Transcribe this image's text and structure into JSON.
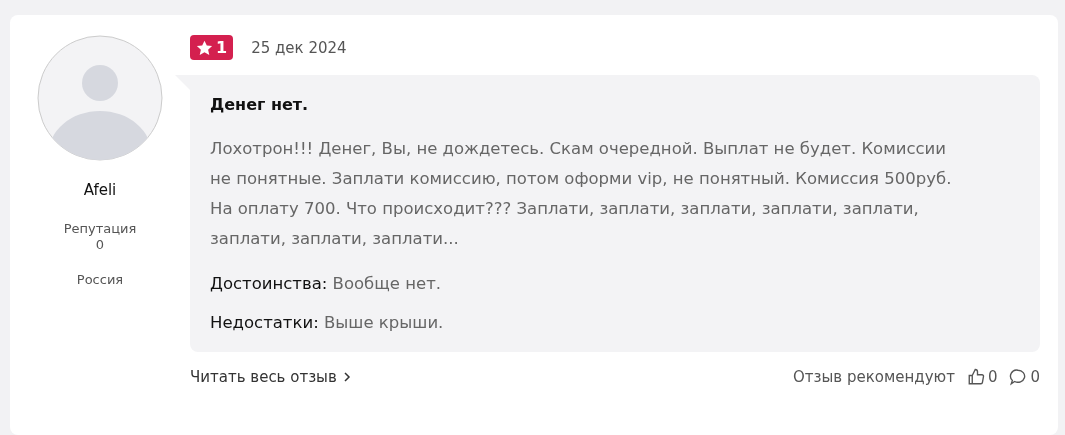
{
  "author": {
    "name": "Afeli",
    "reputation_label": "Репутация",
    "reputation": "0",
    "country": "Россия"
  },
  "review": {
    "rating": "1",
    "date": "25 дек 2024",
    "title": "Денег нет.",
    "body": "Лохотрон!!! Денег, Вы, не дождетесь. Скам очередной. Выплат не будет. Комиссии не понятные. Заплати комиссию, потом оформи vip, не понятный. Комиссия 500руб. На оплату 700. Что происходит??? Заплати, заплати, заплати, заплати, заплати, заплати, заплати, заплати...",
    "points": [
      {
        "label": "Достоинства:",
        "value": "Вообще нет."
      },
      {
        "label": "Недостатки:",
        "value": "Выше крыши."
      }
    ]
  },
  "footer": {
    "read_more": "Читать весь отзыв",
    "recommend_label": "Отзыв рекомендуют",
    "likes": "0",
    "comments": "0"
  }
}
